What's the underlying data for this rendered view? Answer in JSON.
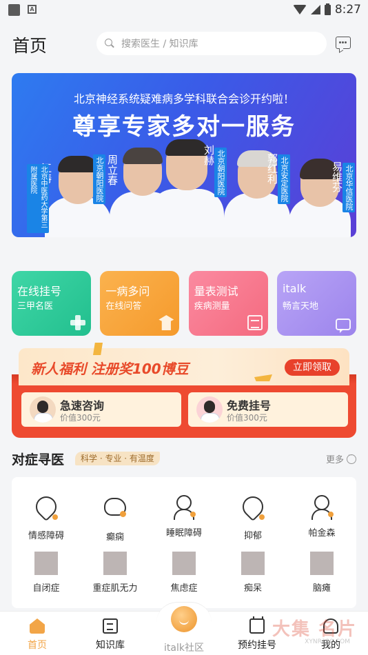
{
  "status_bar": {
    "time": "8:27"
  },
  "header": {
    "title": "首页",
    "search_placeholder": "搜索医生 / 知识库"
  },
  "banner": {
    "subtitle": "北京神经系统疑难病多学科联合会诊开约啦！",
    "title": "尊享专家多对一服务",
    "doctors": [
      {
        "name": "江涛",
        "hospital": "北京中医药大学第三附属医院"
      },
      {
        "name": "周立春",
        "hospital": "北京朝阳医院"
      },
      {
        "name": "刘赫",
        "hospital": "北京朝阳医院"
      },
      {
        "name": "郭红利",
        "hospital": "北京安定医院"
      },
      {
        "name": "易维芬",
        "hospital": "北京华信医院"
      }
    ]
  },
  "tiles": [
    {
      "title": "在线挂号",
      "subtitle": "三甲名医",
      "color": "#2ec99a"
    },
    {
      "title": "一病多问",
      "subtitle": "在线问答",
      "color": "#f8a83c"
    },
    {
      "title": "量表测试",
      "subtitle": "疾病测量",
      "color": "#f77a8e"
    },
    {
      "title": "italk",
      "subtitle": "畅言天地",
      "color": "#a48cf0"
    }
  ],
  "promo": {
    "text": "新人福利 注册奖100博豆",
    "button": "立即领取",
    "cards": [
      {
        "title": "急速咨询",
        "subtitle": "价值300元"
      },
      {
        "title": "免费挂号",
        "subtitle": "价值300元"
      }
    ]
  },
  "section": {
    "title": "对症寻医",
    "tag": "科学 · 专业 · 有温度",
    "more": "更多"
  },
  "symptoms": [
    {
      "label": "情感障碍",
      "icon": "broken-heart-icon"
    },
    {
      "label": "癫痫",
      "icon": "brain-icon"
    },
    {
      "label": "睡眠障碍",
      "icon": "sleep-person-icon"
    },
    {
      "label": "抑郁",
      "icon": "heart-icon"
    },
    {
      "label": "帕金森",
      "icon": "person-icon"
    },
    {
      "label": "自闭症",
      "icon": "placeholder-icon"
    },
    {
      "label": "重症肌无力",
      "icon": "placeholder-icon"
    },
    {
      "label": "焦虑症",
      "icon": "placeholder-icon"
    },
    {
      "label": "痴呆",
      "icon": "placeholder-icon"
    },
    {
      "label": "脑瘫",
      "icon": "placeholder-icon"
    }
  ],
  "tabbar": [
    {
      "label": "首页",
      "icon": "home-icon"
    },
    {
      "label": "知识库",
      "icon": "book-icon"
    },
    {
      "label": "italk社区",
      "icon": "italk-logo-icon"
    },
    {
      "label": "预约挂号",
      "icon": "calendar-icon"
    },
    {
      "label": "我的",
      "icon": "profile-icon"
    }
  ],
  "watermark": {
    "text": "大集 名片",
    "url": "XYNR120.COM"
  }
}
